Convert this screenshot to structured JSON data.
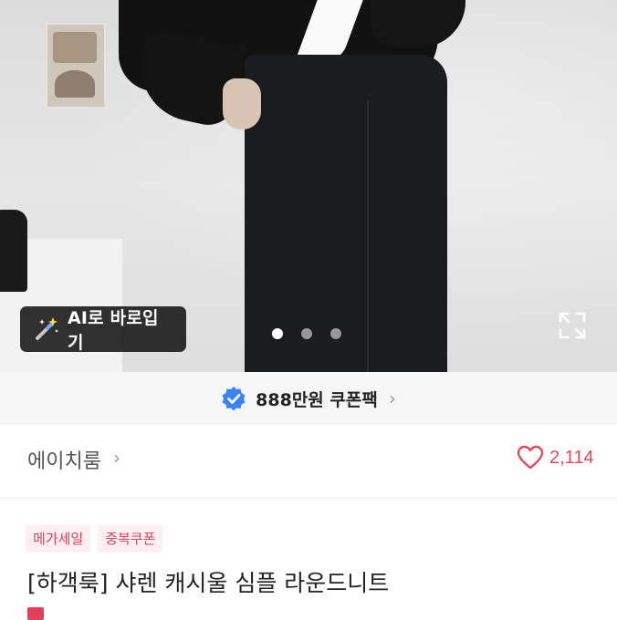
{
  "hero": {
    "ai_button_label": "AI로 바로입기",
    "ai_icon": "magic-wand-icon",
    "expand_icon": "expand-icon",
    "carousel": {
      "total": 3,
      "active_index": 0
    }
  },
  "coupon_bar": {
    "icon": "verified-badge-icon",
    "text": "888만원 쿠폰팩",
    "chevron": "›"
  },
  "store": {
    "name": "에이치룸",
    "chevron": "›",
    "like_icon": "heart-outline-icon",
    "like_count": "2,114"
  },
  "product": {
    "tags": [
      "메가세일",
      "중복쿠폰"
    ],
    "title": "[하객룩] 샤렌 캐시울 심플 라운드니트"
  },
  "colors": {
    "accent": "#e4495e",
    "tag_bg": "#fdeef2",
    "coupon_badge": "#3b82f6"
  }
}
